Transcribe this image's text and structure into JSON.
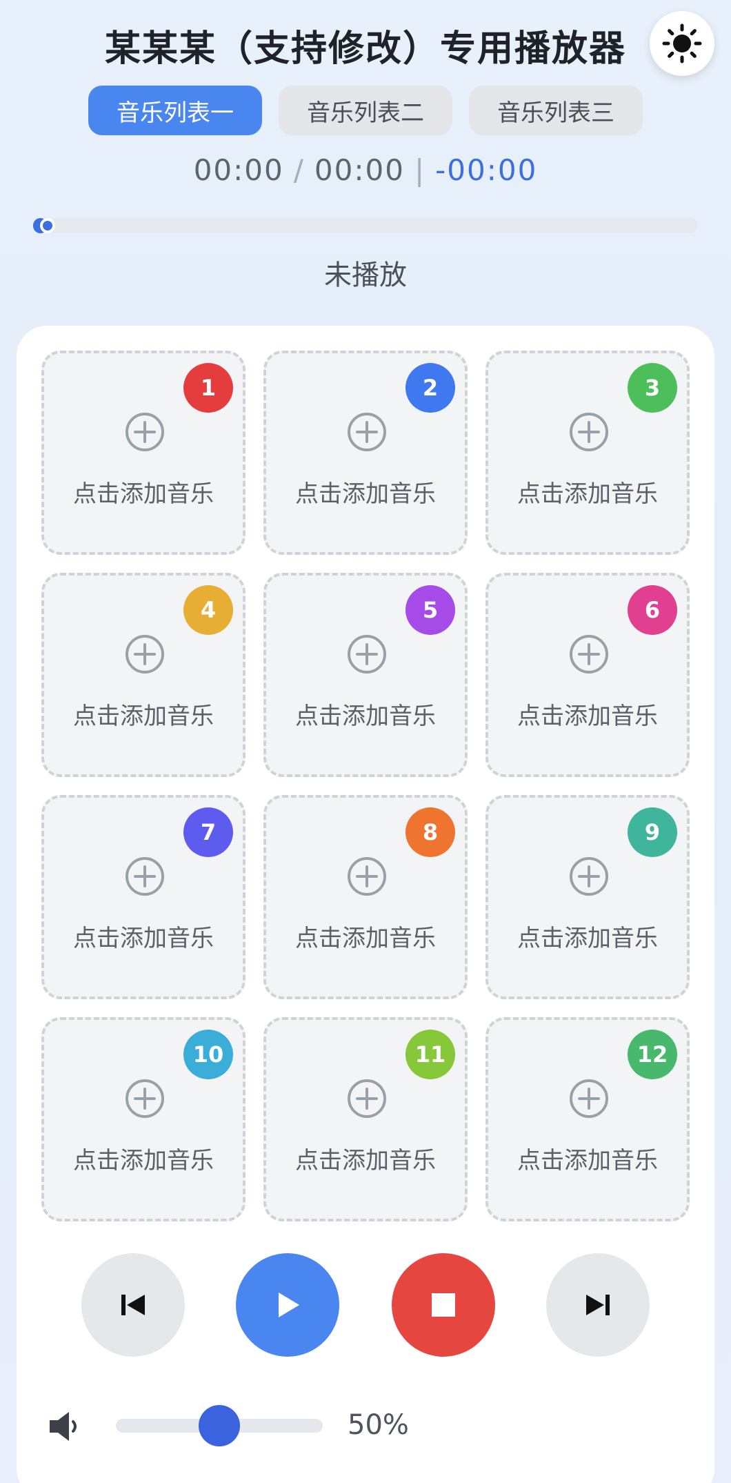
{
  "header": {
    "title": "某某某（支持修改）专用播放器",
    "theme_icon": "sun-icon"
  },
  "tabs": [
    {
      "label": "音乐列表一",
      "active": true
    },
    {
      "label": "音乐列表二",
      "active": false
    },
    {
      "label": "音乐列表三",
      "active": false
    }
  ],
  "time": {
    "current": "00:00",
    "separator": "/",
    "total": "00:00",
    "divider": "|",
    "remaining": "-00:00"
  },
  "progress": {
    "fraction": 0.01
  },
  "status": "未播放",
  "slots": [
    {
      "number": "1",
      "label": "点击添加音乐",
      "color": "#e53d3d"
    },
    {
      "number": "2",
      "label": "点击添加音乐",
      "color": "#3f78ef"
    },
    {
      "number": "3",
      "label": "点击添加音乐",
      "color": "#4cbf5a"
    },
    {
      "number": "4",
      "label": "点击添加音乐",
      "color": "#e8ae33"
    },
    {
      "number": "5",
      "label": "点击添加音乐",
      "color": "#a64ae8"
    },
    {
      "number": "6",
      "label": "点击添加音乐",
      "color": "#e0408f"
    },
    {
      "number": "7",
      "label": "点击添加音乐",
      "color": "#5e5cee"
    },
    {
      "number": "8",
      "label": "点击添加音乐",
      "color": "#ee7430"
    },
    {
      "number": "9",
      "label": "点击添加音乐",
      "color": "#3fb59b"
    },
    {
      "number": "10",
      "label": "点击添加音乐",
      "color": "#3aaed8"
    },
    {
      "number": "11",
      "label": "点击添加音乐",
      "color": "#86c83a"
    },
    {
      "number": "12",
      "label": "点击添加音乐",
      "color": "#48b86c"
    }
  ],
  "controls": {
    "prev_icon": "skip-previous-icon",
    "play_icon": "play-icon",
    "stop_icon": "stop-icon",
    "next_icon": "skip-next-icon"
  },
  "volume": {
    "icon": "speaker-icon",
    "level": 0.5,
    "label": "50%"
  },
  "colors": {
    "accent": "#4a86f0",
    "stop": "#e5463f",
    "progress": "#3b6fe0"
  }
}
